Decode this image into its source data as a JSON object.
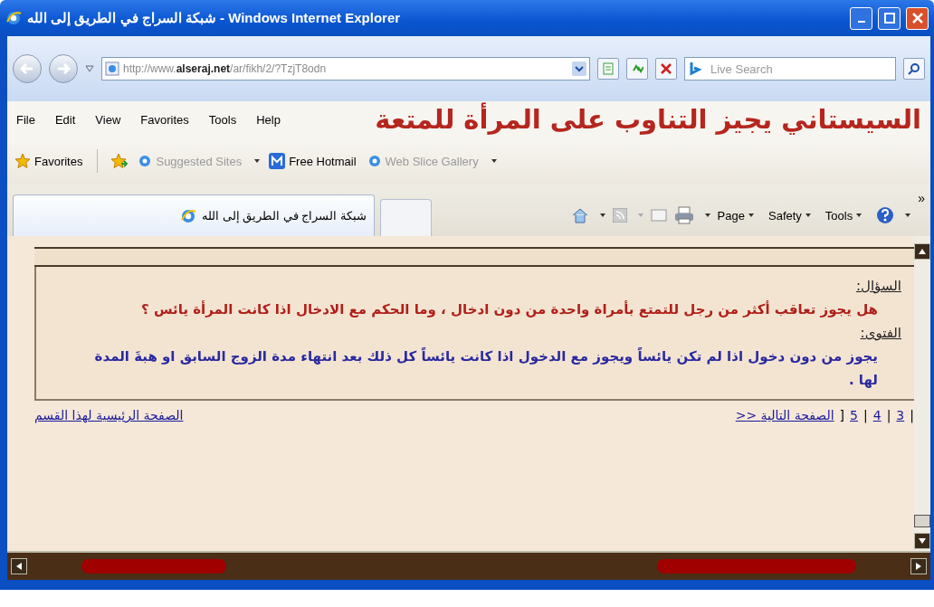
{
  "window": {
    "title": "شبكة السراج في الطريق إلى الله - Windows Internet Explorer"
  },
  "address_bar": {
    "url": "http://www.**alseraj.net**/ar/fikh/2/?TzjT8odn"
  },
  "search": {
    "placeholder": "Live Search"
  },
  "menu": [
    "Help",
    "Tools",
    "Favorites",
    "View",
    "Edit",
    "File"
  ],
  "overlay_caption": "السيستاني يجيز التناوب على المرأة للمتعة",
  "favorites_bar": {
    "label": "Favorites",
    "links": [
      {
        "label": "Web Slice Gallery",
        "dropdown": true,
        "disabled": true
      },
      {
        "label": "Free Hotmail",
        "dropdown": false,
        "disabled": false
      },
      {
        "label": "Suggested Sites",
        "dropdown": true,
        "disabled": true
      }
    ]
  },
  "tabs": [
    {
      "label": "شبكة السراج في الطريق إلى الله",
      "selected": true
    }
  ],
  "command_bar": {
    "menus": [
      "Tools",
      "Safety",
      "Page"
    ],
    "overflow": "»"
  },
  "content": {
    "question_label": "السؤال:",
    "question": "هل يجوز تعاقب أكثر من رجل للتمتع بأمراة واحدة من دون ادخال ، وما الحكم مع الادخال اذا كانت المرأة يائس ؟",
    "answer_label": "الفتوى:",
    "answer": "يجوز من دون دخول اذا لم تكن يائساً ويجوز مع الدخول اذا كانت يائساً كل ذلك بعد انتهاء مدة الزوج السابق او هبةَ المدة لها .",
    "pager": {
      "opening": "|",
      "pages": [
        "3",
        "4",
        "5"
      ],
      "separator": "|",
      "closing": "]",
      "next": ">> الصفحة التالية"
    },
    "section_home": "الصفحة الرئيسية لهذا القسم"
  }
}
